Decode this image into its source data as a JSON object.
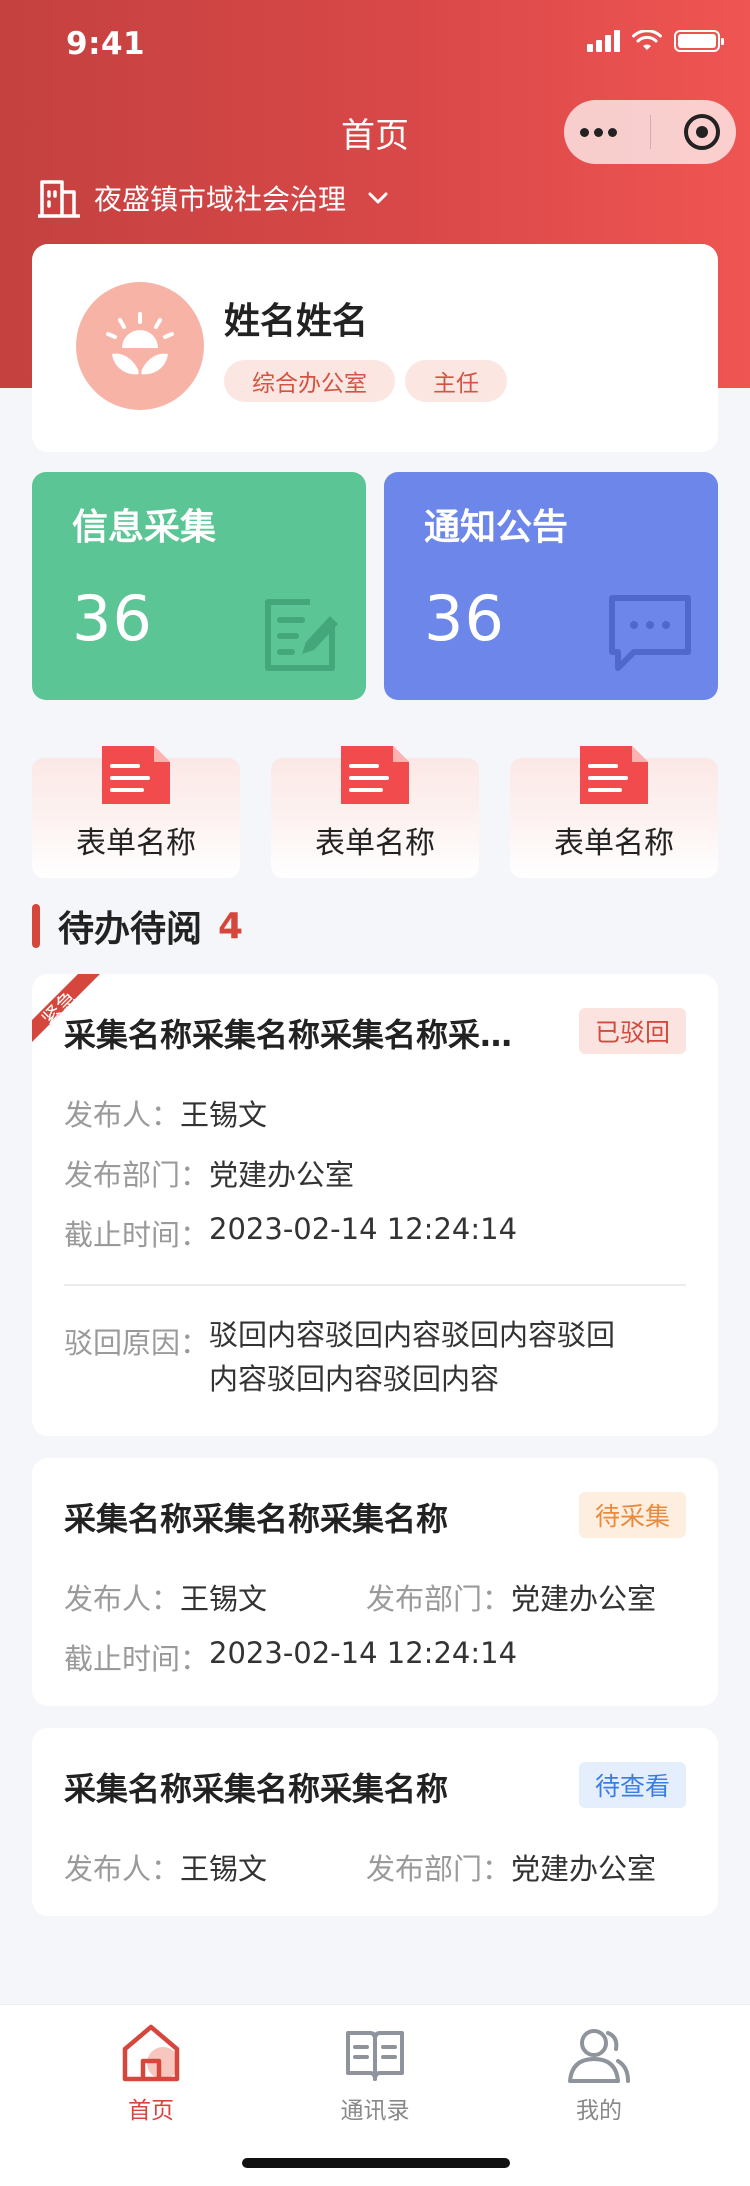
{
  "status_bar": {
    "time": "9:41"
  },
  "nav": {
    "title": "首页"
  },
  "location": {
    "name": "夜盛镇市域社会治理"
  },
  "profile": {
    "name": "姓名姓名",
    "tags": [
      "综合办公室",
      "主任"
    ]
  },
  "stats": [
    {
      "label": "信息采集",
      "value": "36",
      "color": "#5cc595"
    },
    {
      "label": "通知公告",
      "value": "36",
      "color": "#6d86ea"
    }
  ],
  "forms": [
    {
      "label": "表单名称"
    },
    {
      "label": "表单名称"
    },
    {
      "label": "表单名称"
    }
  ],
  "todo": {
    "title": "待办待阅",
    "count": "4"
  },
  "tasks": [
    {
      "urgent_label": "紧急",
      "title": "采集名称采集名称采集名称采集名称",
      "status": "已驳回",
      "publisher_label": "发布人：",
      "publisher": "王锡文",
      "dept_label": "发布部门：",
      "dept": "党建办公室",
      "deadline_label": "截止时间：",
      "deadline": "2023-02-14 12:24:14",
      "reject_label": "驳回原因：",
      "reject_line1": "驳回内容驳回内容驳回内容驳回",
      "reject_line2": "内容驳回内容驳回内容"
    },
    {
      "title": "采集名称采集名称采集名称",
      "status": "待采集",
      "publisher_label": "发布人：",
      "publisher": "王锡文",
      "dept_label": "发布部门：",
      "dept": "党建办公室",
      "deadline_label": "截止时间：",
      "deadline": "2023-02-14 12:24:14"
    },
    {
      "title": "采集名称采集名称采集名称",
      "status": "待查看",
      "publisher_label": "发布人：",
      "publisher": "王锡文",
      "dept_label": "发布部门：",
      "dept": "党建办公室"
    }
  ],
  "tabbar": [
    {
      "label": "首页",
      "icon": "home-icon",
      "active": true
    },
    {
      "label": "通讯录",
      "icon": "contacts-book-icon",
      "active": false
    },
    {
      "label": "我的",
      "icon": "user-profile-icon",
      "active": false
    }
  ],
  "colors": {
    "primary": "#d5473c",
    "green": "#5cc595",
    "blue": "#6d86ea"
  }
}
